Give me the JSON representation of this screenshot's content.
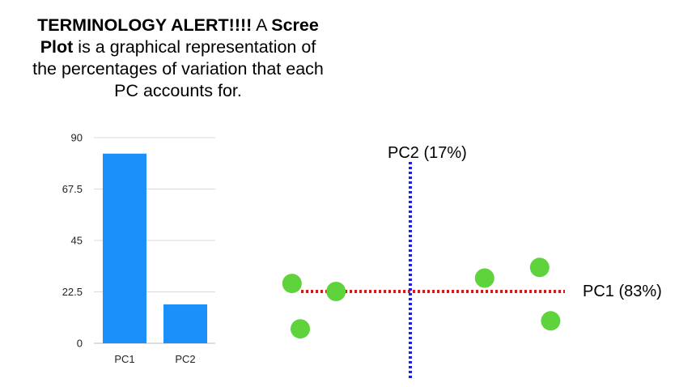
{
  "caption": {
    "line1_bold": "TERMINOLOGY ALERT!!!!",
    "line1_plain": " A ",
    "line1_bold2": "Scree",
    "line2_bold": "Plot",
    "line2_plain": " is a graphical representation of",
    "line3": "the percentages of variation that each",
    "line4": "PC accounts for."
  },
  "chart_data": [
    {
      "type": "bar",
      "categories": [
        "PC1",
        "PC2"
      ],
      "values": [
        83,
        17
      ],
      "yticks": [
        "0",
        "22.5",
        "45",
        "67.5",
        "90"
      ],
      "ylim": [
        0,
        90
      ],
      "grid": true,
      "bar_color": "#1a90fb"
    },
    {
      "type": "scatter",
      "axes": {
        "pc1_label": "PC1 (83%)",
        "pc2_label": "PC2 (17%)",
        "pc1_color": "#c8201e",
        "pc2_color": "#1b22d8"
      },
      "point_color": "#5fd33b",
      "points": [
        {
          "x": -4.3,
          "y": 0.3
        },
        {
          "x": -2.7,
          "y": 0.0
        },
        {
          "x": -4.0,
          "y": -1.4
        },
        {
          "x": 2.7,
          "y": 0.5
        },
        {
          "x": 4.7,
          "y": 0.9
        },
        {
          "x": 5.1,
          "y": -1.1
        }
      ]
    }
  ]
}
